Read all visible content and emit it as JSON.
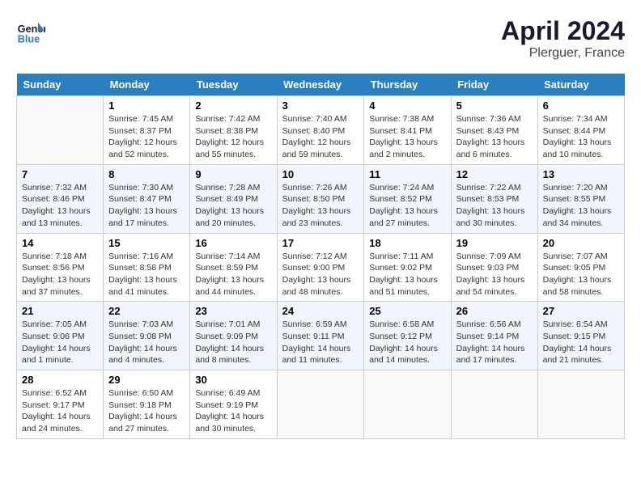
{
  "header": {
    "logo_general": "General",
    "logo_blue": "Blue",
    "month": "April 2024",
    "location": "Plerguer, France"
  },
  "days_of_week": [
    "Sunday",
    "Monday",
    "Tuesday",
    "Wednesday",
    "Thursday",
    "Friday",
    "Saturday"
  ],
  "weeks": [
    [
      {
        "num": "",
        "info": ""
      },
      {
        "num": "1",
        "info": "Sunrise: 7:45 AM\nSunset: 8:37 PM\nDaylight: 12 hours\nand 52 minutes."
      },
      {
        "num": "2",
        "info": "Sunrise: 7:42 AM\nSunset: 8:38 PM\nDaylight: 12 hours\nand 55 minutes."
      },
      {
        "num": "3",
        "info": "Sunrise: 7:40 AM\nSunset: 8:40 PM\nDaylight: 12 hours\nand 59 minutes."
      },
      {
        "num": "4",
        "info": "Sunrise: 7:38 AM\nSunset: 8:41 PM\nDaylight: 13 hours\nand 2 minutes."
      },
      {
        "num": "5",
        "info": "Sunrise: 7:36 AM\nSunset: 8:43 PM\nDaylight: 13 hours\nand 6 minutes."
      },
      {
        "num": "6",
        "info": "Sunrise: 7:34 AM\nSunset: 8:44 PM\nDaylight: 13 hours\nand 10 minutes."
      }
    ],
    [
      {
        "num": "7",
        "info": "Sunrise: 7:32 AM\nSunset: 8:46 PM\nDaylight: 13 hours\nand 13 minutes."
      },
      {
        "num": "8",
        "info": "Sunrise: 7:30 AM\nSunset: 8:47 PM\nDaylight: 13 hours\nand 17 minutes."
      },
      {
        "num": "9",
        "info": "Sunrise: 7:28 AM\nSunset: 8:49 PM\nDaylight: 13 hours\nand 20 minutes."
      },
      {
        "num": "10",
        "info": "Sunrise: 7:26 AM\nSunset: 8:50 PM\nDaylight: 13 hours\nand 23 minutes."
      },
      {
        "num": "11",
        "info": "Sunrise: 7:24 AM\nSunset: 8:52 PM\nDaylight: 13 hours\nand 27 minutes."
      },
      {
        "num": "12",
        "info": "Sunrise: 7:22 AM\nSunset: 8:53 PM\nDaylight: 13 hours\nand 30 minutes."
      },
      {
        "num": "13",
        "info": "Sunrise: 7:20 AM\nSunset: 8:55 PM\nDaylight: 13 hours\nand 34 minutes."
      }
    ],
    [
      {
        "num": "14",
        "info": "Sunrise: 7:18 AM\nSunset: 8:56 PM\nDaylight: 13 hours\nand 37 minutes."
      },
      {
        "num": "15",
        "info": "Sunrise: 7:16 AM\nSunset: 8:58 PM\nDaylight: 13 hours\nand 41 minutes."
      },
      {
        "num": "16",
        "info": "Sunrise: 7:14 AM\nSunset: 8:59 PM\nDaylight: 13 hours\nand 44 minutes."
      },
      {
        "num": "17",
        "info": "Sunrise: 7:12 AM\nSunset: 9:00 PM\nDaylight: 13 hours\nand 48 minutes."
      },
      {
        "num": "18",
        "info": "Sunrise: 7:11 AM\nSunset: 9:02 PM\nDaylight: 13 hours\nand 51 minutes."
      },
      {
        "num": "19",
        "info": "Sunrise: 7:09 AM\nSunset: 9:03 PM\nDaylight: 13 hours\nand 54 minutes."
      },
      {
        "num": "20",
        "info": "Sunrise: 7:07 AM\nSunset: 9:05 PM\nDaylight: 13 hours\nand 58 minutes."
      }
    ],
    [
      {
        "num": "21",
        "info": "Sunrise: 7:05 AM\nSunset: 9:06 PM\nDaylight: 14 hours\nand 1 minute."
      },
      {
        "num": "22",
        "info": "Sunrise: 7:03 AM\nSunset: 9:08 PM\nDaylight: 14 hours\nand 4 minutes."
      },
      {
        "num": "23",
        "info": "Sunrise: 7:01 AM\nSunset: 9:09 PM\nDaylight: 14 hours\nand 8 minutes."
      },
      {
        "num": "24",
        "info": "Sunrise: 6:59 AM\nSunset: 9:11 PM\nDaylight: 14 hours\nand 11 minutes."
      },
      {
        "num": "25",
        "info": "Sunrise: 6:58 AM\nSunset: 9:12 PM\nDaylight: 14 hours\nand 14 minutes."
      },
      {
        "num": "26",
        "info": "Sunrise: 6:56 AM\nSunset: 9:14 PM\nDaylight: 14 hours\nand 17 minutes."
      },
      {
        "num": "27",
        "info": "Sunrise: 6:54 AM\nSunset: 9:15 PM\nDaylight: 14 hours\nand 21 minutes."
      }
    ],
    [
      {
        "num": "28",
        "info": "Sunrise: 6:52 AM\nSunset: 9:17 PM\nDaylight: 14 hours\nand 24 minutes."
      },
      {
        "num": "29",
        "info": "Sunrise: 6:50 AM\nSunset: 9:18 PM\nDaylight: 14 hours\nand 27 minutes."
      },
      {
        "num": "30",
        "info": "Sunrise: 6:49 AM\nSunset: 9:19 PM\nDaylight: 14 hours\nand 30 minutes."
      },
      {
        "num": "",
        "info": ""
      },
      {
        "num": "",
        "info": ""
      },
      {
        "num": "",
        "info": ""
      },
      {
        "num": "",
        "info": ""
      }
    ]
  ]
}
